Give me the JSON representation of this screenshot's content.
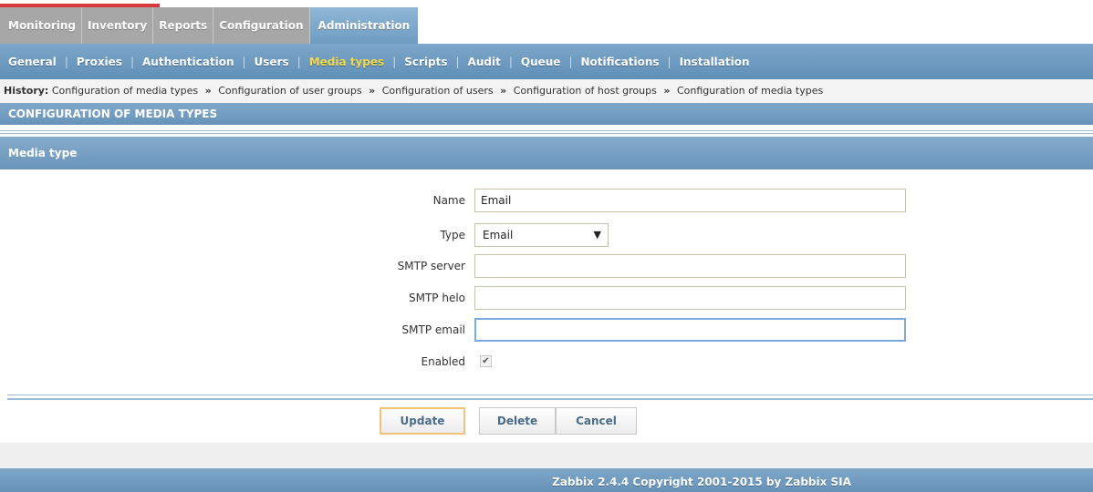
{
  "main_menu": {
    "items": [
      {
        "label": "Monitoring",
        "active": false
      },
      {
        "label": "Inventory",
        "active": false
      },
      {
        "label": "Reports",
        "active": false
      },
      {
        "label": "Configuration",
        "active": false
      },
      {
        "label": "Administration",
        "active": true
      }
    ]
  },
  "sub_menu": {
    "items": [
      {
        "label": "General",
        "active": false
      },
      {
        "label": "Proxies",
        "active": false
      },
      {
        "label": "Authentication",
        "active": false
      },
      {
        "label": "Users",
        "active": false
      },
      {
        "label": "Media types",
        "active": true
      },
      {
        "label": "Scripts",
        "active": false
      },
      {
        "label": "Audit",
        "active": false
      },
      {
        "label": "Queue",
        "active": false
      },
      {
        "label": "Notifications",
        "active": false
      },
      {
        "label": "Installation",
        "active": false
      }
    ],
    "separator": "|"
  },
  "history": {
    "label": "History:",
    "separator": "»",
    "items": [
      "Configuration of media types",
      "Configuration of user groups",
      "Configuration of users",
      "Configuration of host groups",
      "Configuration of media types"
    ]
  },
  "page_title": "CONFIGURATION OF MEDIA TYPES",
  "form": {
    "title": "Media type",
    "name_label": "Name",
    "name_value": "Email",
    "type_label": "Type",
    "type_value": "Email",
    "smtp_server_label": "SMTP server",
    "smtp_server_value": "",
    "smtp_helo_label": "SMTP helo",
    "smtp_helo_value": "",
    "smtp_email_label": "SMTP email",
    "smtp_email_value": "",
    "enabled_label": "Enabled",
    "enabled_checked": true
  },
  "buttons": {
    "update": "Update",
    "delete": "Delete",
    "cancel": "Cancel"
  },
  "footer": "Zabbix 2.4.4 Copyright 2001-2015 by Zabbix SIA",
  "colors": {
    "menu_blue": "#6e9dc2",
    "active_sub_item": "#f5d94a",
    "inactive_tab": "#a7a7a7"
  }
}
